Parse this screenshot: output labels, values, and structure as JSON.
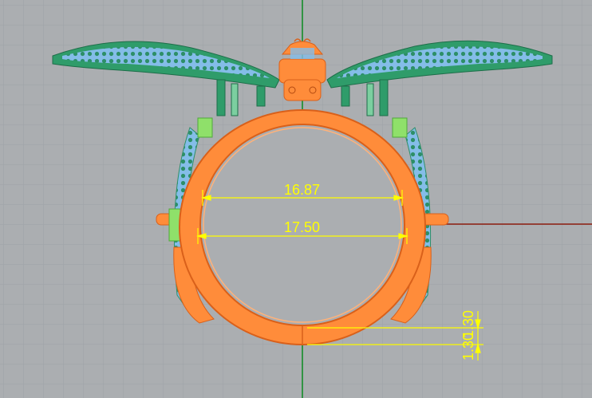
{
  "viewport": {
    "name": "Front",
    "background": "#abaeb1",
    "grid_color": "#9ea2a6",
    "x_axis_color": "#8b1c0e",
    "y_axis_color": "#0b8a20"
  },
  "colors": {
    "ring_orange": "#ff8c3a",
    "ring_stroke": "#d9601a",
    "wing_green": "#2f9c6a",
    "wing_stone_blue": "#7fb6e6",
    "accent_lime": "#8fe06a",
    "dimension_yellow": "#ffff00"
  },
  "dimensions": {
    "inner_diameter": "16.87",
    "outer_diameter": "17.50",
    "band_thickness_1": "1.30",
    "band_thickness_2": "1.30"
  }
}
